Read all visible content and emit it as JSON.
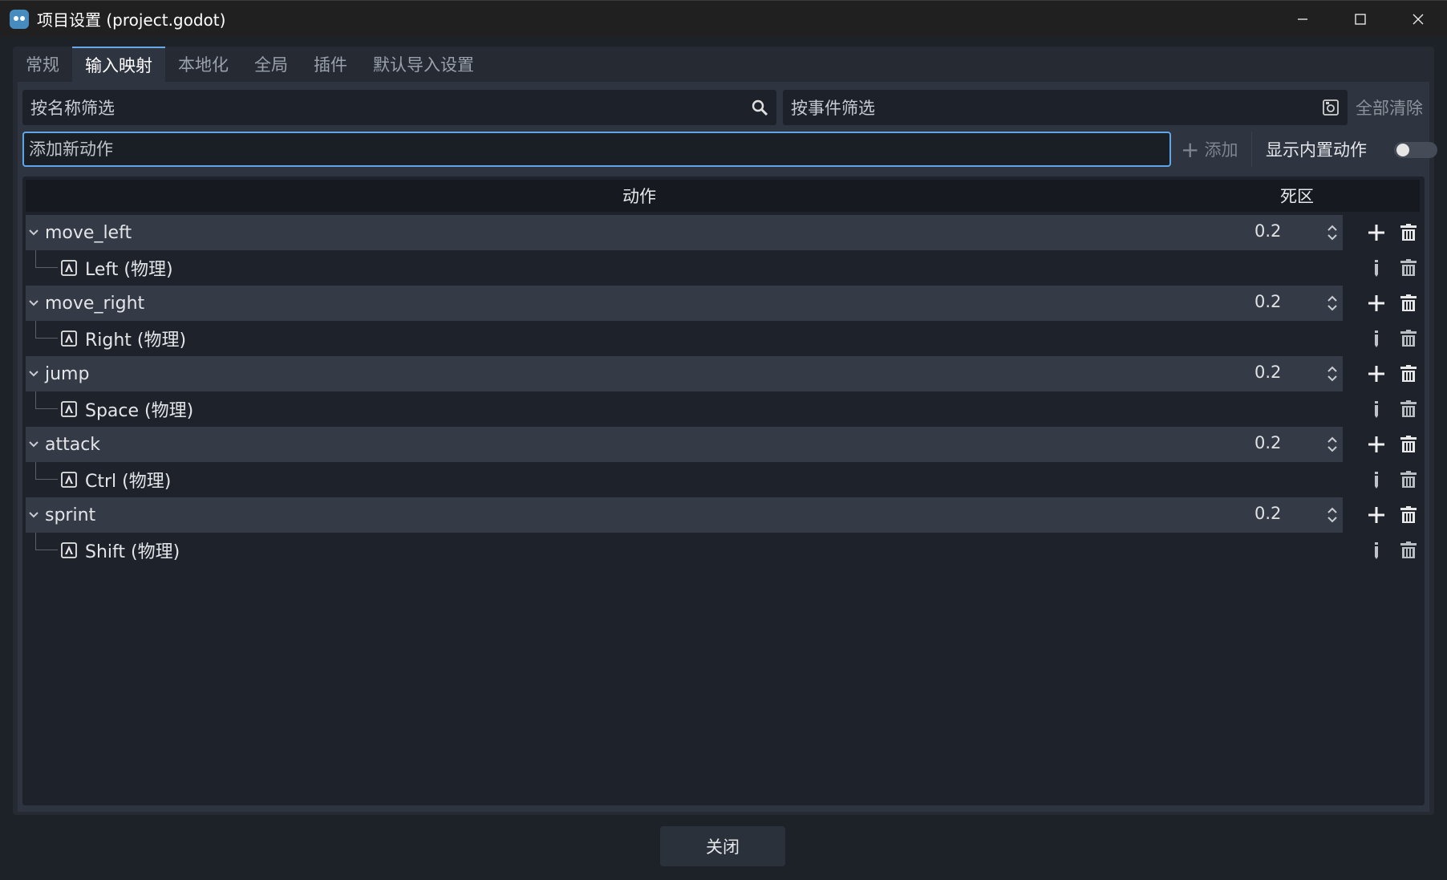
{
  "window": {
    "title": "项目设置 (project.godot)"
  },
  "tabs": [
    {
      "label": "常规",
      "active": false
    },
    {
      "label": "输入映射",
      "active": true
    },
    {
      "label": "本地化",
      "active": false
    },
    {
      "label": "全局",
      "active": false
    },
    {
      "label": "插件",
      "active": false
    },
    {
      "label": "默认导入设置",
      "active": false
    }
  ],
  "filters": {
    "name_placeholder": "按名称筛选",
    "event_placeholder": "按事件筛选",
    "clear_all_label": "全部清除"
  },
  "new_action": {
    "placeholder": "添加新动作",
    "add_label": "添加",
    "show_builtin_label": "显示内置动作",
    "show_builtin_enabled": false
  },
  "table": {
    "header_action": "动作",
    "header_deadzone": "死区"
  },
  "actions": [
    {
      "name": "move_left",
      "deadzone": "0.2",
      "event": "Left (物理)"
    },
    {
      "name": "move_right",
      "deadzone": "0.2",
      "event": "Right (物理)"
    },
    {
      "name": "jump",
      "deadzone": "0.2",
      "event": "Space (物理)"
    },
    {
      "name": "attack",
      "deadzone": "0.2",
      "event": "Ctrl (物理)"
    },
    {
      "name": "sprint",
      "deadzone": "0.2",
      "event": "Shift (物理)"
    }
  ],
  "footer": {
    "close_label": "关闭"
  },
  "icons": {
    "app": "godot-icon",
    "name_filter": "search-icon",
    "event_filter": "keyboard-filter-icon",
    "add": "plus-icon",
    "expand": "chevron-down-icon",
    "key": "keyboard-key-icon",
    "spin": "spinbox-arrows-icon",
    "edit": "edit-icon",
    "delete": "trash-icon"
  },
  "colors": {
    "accent": "#5ea6e8",
    "background": "#1d2229",
    "panel": "#2e3440"
  }
}
